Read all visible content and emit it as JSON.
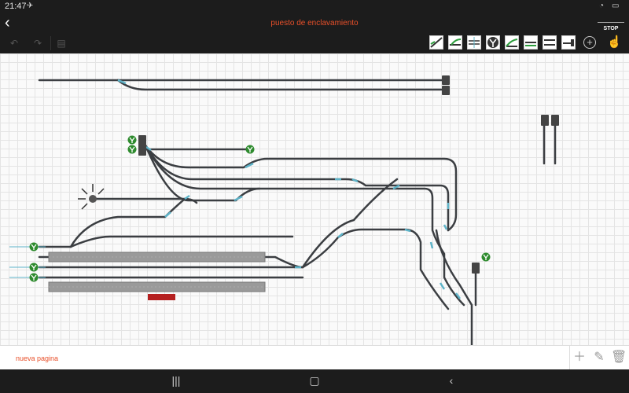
{
  "status_bar": {
    "time": "21:47",
    "battery": ""
  },
  "header": {
    "title": "puesto de enclavamiento",
    "stop_label": "STOP"
  },
  "toolbar": {
    "tiles": [
      "straight-track-icon",
      "diagonal-track-icon",
      "crossing-track-icon",
      "turntable-icon",
      "switch-left-icon",
      "switch-right-icon",
      "double-track-icon",
      "buffer-stop-icon"
    ]
  },
  "footer": {
    "page_name": "nueva pagina"
  },
  "colors": {
    "accent": "#e8502a",
    "track": "#3b3e42",
    "switch_highlight": "#5fb4c9",
    "signal_green": "#2e8b2e"
  }
}
